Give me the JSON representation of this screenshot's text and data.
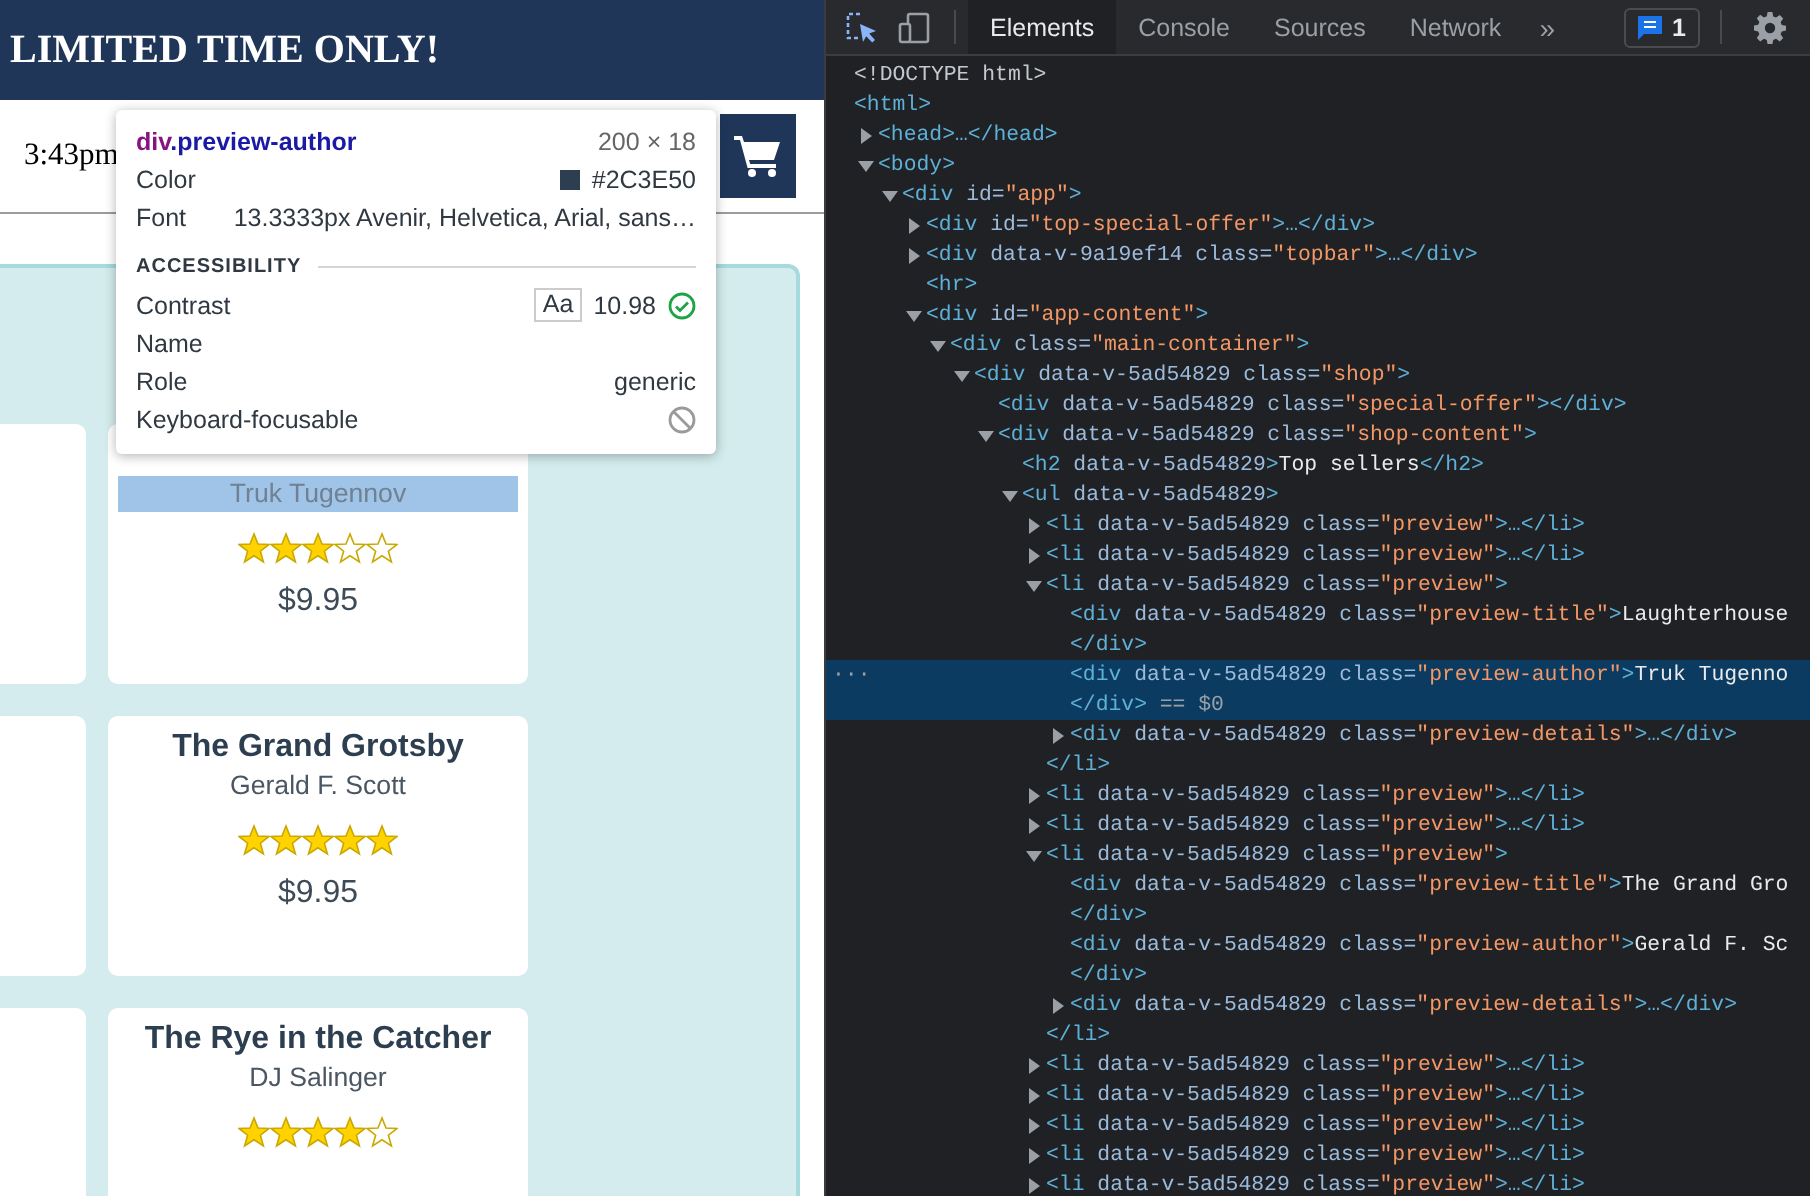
{
  "shop": {
    "banner": "LIMITED TIME ONLY!",
    "time": "3:43pm",
    "books": [
      {
        "author": "Truk Tugennov",
        "stars": 3,
        "price": "$9.95",
        "inspected": true
      },
      {
        "title": "The Grand Grotsby",
        "author": "Gerald F. Scott",
        "stars": 5,
        "price": "$9.95",
        "inspected": false
      },
      {
        "title": "The Rye in the Catcher",
        "author": "DJ Salinger",
        "stars": 4,
        "inspected": false
      }
    ]
  },
  "inspect_tooltip": {
    "tag": "div",
    "selector": ".preview-author",
    "size": "200 × 18",
    "properties": [
      {
        "label": "Color",
        "value": "#2C3E50",
        "color": "#2c3e50"
      },
      {
        "label": "Font",
        "value": "13.3333px Avenir, Helvetica, Arial, sans…"
      }
    ],
    "section": "ACCESSIBILITY",
    "accessibility": [
      {
        "kind": "contrast",
        "label": "Contrast",
        "sample": "Aa",
        "value": "10.98",
        "passes": true
      },
      {
        "kind": "text",
        "label": "Name"
      },
      {
        "kind": "text",
        "label": "Role",
        "value": "generic"
      },
      {
        "kind": "focusable",
        "label": "Keyboard-focusable",
        "focusable": false
      }
    ]
  },
  "devtools": {
    "tabs": [
      {
        "label": "Elements",
        "selected": true
      },
      {
        "label": "Console",
        "selected": false
      },
      {
        "label": "Sources",
        "selected": false
      },
      {
        "label": "Network",
        "selected": false
      }
    ],
    "more": "»",
    "issues_count": "1",
    "row_menu": "···",
    "tree": [
      {
        "line": [
          {
            "kind": "doctype",
            "text": "<!DOCTYPE html>"
          }
        ],
        "selected": false
      },
      {
        "line": [
          {
            "kind": "tag",
            "text": "<html>"
          }
        ],
        "selected": false,
        "children": [
          {
            "line": [
              {
                "kind": "tag",
                "text": "<head>…</head>"
              }
            ],
            "expanded": false,
            "selected": false
          },
          {
            "line": [
              {
                "kind": "tag",
                "text": "<body>"
              }
            ],
            "expanded": true,
            "selected": false,
            "children": [
              {
                "line": [
                  {
                    "kind": "tag",
                    "text": "<div"
                  },
                  {
                    "kind": "attr",
                    "text": " id="
                  },
                  {
                    "kind": "value",
                    "text": "\"app\""
                  },
                  {
                    "kind": "tag",
                    "text": ">"
                  }
                ],
                "expanded": true,
                "selected": false,
                "children": [
                  {
                    "line": [
                      {
                        "kind": "tag",
                        "text": "<div"
                      },
                      {
                        "kind": "attr",
                        "text": " id="
                      },
                      {
                        "kind": "value",
                        "text": "\"top-special-offer\""
                      },
                      {
                        "kind": "tag",
                        "text": ">…</div>"
                      }
                    ],
                    "expanded": false,
                    "selected": false
                  },
                  {
                    "line": [
                      {
                        "kind": "tag",
                        "text": "<div"
                      },
                      {
                        "kind": "attr",
                        "text": " data-v-9a19ef14 class="
                      },
                      {
                        "kind": "value",
                        "text": "\"topbar\""
                      },
                      {
                        "kind": "tag",
                        "text": ">…</div>"
                      }
                    ],
                    "expanded": false,
                    "selected": false
                  },
                  {
                    "line": [
                      {
                        "kind": "tag",
                        "text": "<hr>"
                      }
                    ],
                    "selected": false
                  },
                  {
                    "line": [
                      {
                        "kind": "tag",
                        "text": "<div"
                      },
                      {
                        "kind": "attr",
                        "text": " id="
                      },
                      {
                        "kind": "value",
                        "text": "\"app-content\""
                      },
                      {
                        "kind": "tag",
                        "text": ">"
                      }
                    ],
                    "expanded": true,
                    "selected": false,
                    "children": [
                      {
                        "line": [
                          {
                            "kind": "tag",
                            "text": "<div"
                          },
                          {
                            "kind": "attr",
                            "text": " class="
                          },
                          {
                            "kind": "value",
                            "text": "\"main-container\""
                          },
                          {
                            "kind": "tag",
                            "text": ">"
                          }
                        ],
                        "expanded": true,
                        "selected": false,
                        "children": [
                          {
                            "line": [
                              {
                                "kind": "tag",
                                "text": "<div"
                              },
                              {
                                "kind": "attr",
                                "text": " data-v-5ad54829 class="
                              },
                              {
                                "kind": "value",
                                "text": "\"shop\""
                              },
                              {
                                "kind": "tag",
                                "text": ">"
                              }
                            ],
                            "expanded": true,
                            "selected": false,
                            "children": [
                              {
                                "line": [
                                  {
                                    "kind": "tag",
                                    "text": "<div"
                                  },
                                  {
                                    "kind": "attr",
                                    "text": " data-v-5ad54829 class="
                                  },
                                  {
                                    "kind": "value",
                                    "text": "\"special-offer\""
                                  },
                                  {
                                    "kind": "tag",
                                    "text": "></div>"
                                  }
                                ],
                                "selected": false
                              },
                              {
                                "line": [
                                  {
                                    "kind": "tag",
                                    "text": "<div"
                                  },
                                  {
                                    "kind": "attr",
                                    "text": " data-v-5ad54829 class="
                                  },
                                  {
                                    "kind": "value",
                                    "text": "\"shop-content\""
                                  },
                                  {
                                    "kind": "tag",
                                    "text": ">"
                                  }
                                ],
                                "expanded": true,
                                "selected": false,
                                "children": [
                                  {
                                    "line": [
                                      {
                                        "kind": "tag",
                                        "text": "<h2"
                                      },
                                      {
                                        "kind": "attr",
                                        "text": " data-v-5ad54829"
                                      },
                                      {
                                        "kind": "tag",
                                        "text": ">"
                                      },
                                      {
                                        "kind": "text",
                                        "text": "Top sellers"
                                      },
                                      {
                                        "kind": "tag",
                                        "text": "</h2>"
                                      }
                                    ],
                                    "selected": false
                                  },
                                  {
                                    "line": [
                                      {
                                        "kind": "tag",
                                        "text": "<ul"
                                      },
                                      {
                                        "kind": "attr",
                                        "text": " data-v-5ad54829"
                                      },
                                      {
                                        "kind": "tag",
                                        "text": ">"
                                      }
                                    ],
                                    "expanded": true,
                                    "selected": false,
                                    "children": [
                                      {
                                        "line": [
                                          {
                                            "kind": "tag",
                                            "text": "<li"
                                          },
                                          {
                                            "kind": "attr",
                                            "text": " data-v-5ad54829 class="
                                          },
                                          {
                                            "kind": "value",
                                            "text": "\"preview\""
                                          },
                                          {
                                            "kind": "tag",
                                            "text": ">…</li>"
                                          }
                                        ],
                                        "expanded": false,
                                        "selected": false
                                      },
                                      {
                                        "line": [
                                          {
                                            "kind": "tag",
                                            "text": "<li"
                                          },
                                          {
                                            "kind": "attr",
                                            "text": " data-v-5ad54829 class="
                                          },
                                          {
                                            "kind": "value",
                                            "text": "\"preview\""
                                          },
                                          {
                                            "kind": "tag",
                                            "text": ">…</li>"
                                          }
                                        ],
                                        "expanded": false,
                                        "selected": false
                                      },
                                      {
                                        "line": [
                                          {
                                            "kind": "tag",
                                            "text": "<li"
                                          },
                                          {
                                            "kind": "attr",
                                            "text": " data-v-5ad54829 class="
                                          },
                                          {
                                            "kind": "value",
                                            "text": "\"preview\""
                                          },
                                          {
                                            "kind": "tag",
                                            "text": ">"
                                          }
                                        ],
                                        "expanded": true,
                                        "selected": false,
                                        "end": [
                                          {
                                            "kind": "tag",
                                            "text": "</li>"
                                          }
                                        ],
                                        "children": [
                                          {
                                            "line": [
                                              {
                                                "kind": "tag",
                                                "text": "<div"
                                              },
                                              {
                                                "kind": "attr",
                                                "text": " data-v-5ad54829 class="
                                              },
                                              {
                                                "kind": "value",
                                                "text": "\"preview-title\""
                                              },
                                              {
                                                "kind": "tag",
                                                "text": ">"
                                              },
                                              {
                                                "kind": "text",
                                                "text": "Laughterhouse"
                                              }
                                            ],
                                            "end": [
                                              {
                                                "kind": "tag",
                                                "text": "</div>"
                                              }
                                            ],
                                            "selected": false
                                          },
                                          {
                                            "line": [
                                              {
                                                "kind": "tag",
                                                "text": "<div"
                                              },
                                              {
                                                "kind": "attr",
                                                "text": " data-v-5ad54829 class="
                                              },
                                              {
                                                "kind": "value",
                                                "text": "\"preview-author\""
                                              },
                                              {
                                                "kind": "tag",
                                                "text": ">"
                                              },
                                              {
                                                "kind": "text",
                                                "text": "Truk Tugenno"
                                              }
                                            ],
                                            "end": [
                                              {
                                                "kind": "tag",
                                                "text": "</div>"
                                              },
                                              {
                                                "kind": "meta",
                                                "text": " == $0"
                                              }
                                            ],
                                            "selected": true
                                          },
                                          {
                                            "line": [
                                              {
                                                "kind": "tag",
                                                "text": "<div"
                                              },
                                              {
                                                "kind": "attr",
                                                "text": " data-v-5ad54829 class="
                                              },
                                              {
                                                "kind": "value",
                                                "text": "\"preview-details\""
                                              },
                                              {
                                                "kind": "tag",
                                                "text": ">…</div>"
                                              }
                                            ],
                                            "expanded": false,
                                            "selected": false
                                          }
                                        ]
                                      },
                                      {
                                        "line": [
                                          {
                                            "kind": "tag",
                                            "text": "<li"
                                          },
                                          {
                                            "kind": "attr",
                                            "text": " data-v-5ad54829 class="
                                          },
                                          {
                                            "kind": "value",
                                            "text": "\"preview\""
                                          },
                                          {
                                            "kind": "tag",
                                            "text": ">…</li>"
                                          }
                                        ],
                                        "expanded": false,
                                        "selected": false
                                      },
                                      {
                                        "line": [
                                          {
                                            "kind": "tag",
                                            "text": "<li"
                                          },
                                          {
                                            "kind": "attr",
                                            "text": " data-v-5ad54829 class="
                                          },
                                          {
                                            "kind": "value",
                                            "text": "\"preview\""
                                          },
                                          {
                                            "kind": "tag",
                                            "text": ">…</li>"
                                          }
                                        ],
                                        "expanded": false,
                                        "selected": false
                                      },
                                      {
                                        "line": [
                                          {
                                            "kind": "tag",
                                            "text": "<li"
                                          },
                                          {
                                            "kind": "attr",
                                            "text": " data-v-5ad54829 class="
                                          },
                                          {
                                            "kind": "value",
                                            "text": "\"preview\""
                                          },
                                          {
                                            "kind": "tag",
                                            "text": ">"
                                          }
                                        ],
                                        "expanded": true,
                                        "selected": false,
                                        "end": [
                                          {
                                            "kind": "tag",
                                            "text": "</li>"
                                          }
                                        ],
                                        "children": [
                                          {
                                            "line": [
                                              {
                                                "kind": "tag",
                                                "text": "<div"
                                              },
                                              {
                                                "kind": "attr",
                                                "text": " data-v-5ad54829 class="
                                              },
                                              {
                                                "kind": "value",
                                                "text": "\"preview-title\""
                                              },
                                              {
                                                "kind": "tag",
                                                "text": ">"
                                              },
                                              {
                                                "kind": "text",
                                                "text": "The Grand Gro"
                                              }
                                            ],
                                            "end": [
                                              {
                                                "kind": "tag",
                                                "text": "</div>"
                                              }
                                            ],
                                            "selected": false
                                          },
                                          {
                                            "line": [
                                              {
                                                "kind": "tag",
                                                "text": "<div"
                                              },
                                              {
                                                "kind": "attr",
                                                "text": " data-v-5ad54829 class="
                                              },
                                              {
                                                "kind": "value",
                                                "text": "\"preview-author\""
                                              },
                                              {
                                                "kind": "tag",
                                                "text": ">"
                                              },
                                              {
                                                "kind": "text",
                                                "text": "Gerald F. Sc"
                                              }
                                            ],
                                            "end": [
                                              {
                                                "kind": "tag",
                                                "text": "</div>"
                                              }
                                            ],
                                            "selected": false
                                          },
                                          {
                                            "line": [
                                              {
                                                "kind": "tag",
                                                "text": "<div"
                                              },
                                              {
                                                "kind": "attr",
                                                "text": " data-v-5ad54829 class="
                                              },
                                              {
                                                "kind": "value",
                                                "text": "\"preview-details\""
                                              },
                                              {
                                                "kind": "tag",
                                                "text": ">…</div>"
                                              }
                                            ],
                                            "expanded": false,
                                            "selected": false
                                          }
                                        ]
                                      },
                                      {
                                        "line": [
                                          {
                                            "kind": "tag",
                                            "text": "<li"
                                          },
                                          {
                                            "kind": "attr",
                                            "text": " data-v-5ad54829 class="
                                          },
                                          {
                                            "kind": "value",
                                            "text": "\"preview\""
                                          },
                                          {
                                            "kind": "tag",
                                            "text": ">…</li>"
                                          }
                                        ],
                                        "expanded": false,
                                        "selected": false
                                      },
                                      {
                                        "line": [
                                          {
                                            "kind": "tag",
                                            "text": "<li"
                                          },
                                          {
                                            "kind": "attr",
                                            "text": " data-v-5ad54829 class="
                                          },
                                          {
                                            "kind": "value",
                                            "text": "\"preview\""
                                          },
                                          {
                                            "kind": "tag",
                                            "text": ">…</li>"
                                          }
                                        ],
                                        "expanded": false,
                                        "selected": false
                                      },
                                      {
                                        "line": [
                                          {
                                            "kind": "tag",
                                            "text": "<li"
                                          },
                                          {
                                            "kind": "attr",
                                            "text": " data-v-5ad54829 class="
                                          },
                                          {
                                            "kind": "value",
                                            "text": "\"preview\""
                                          },
                                          {
                                            "kind": "tag",
                                            "text": ">…</li>"
                                          }
                                        ],
                                        "expanded": false,
                                        "selected": false
                                      },
                                      {
                                        "line": [
                                          {
                                            "kind": "tag",
                                            "text": "<li"
                                          },
                                          {
                                            "kind": "attr",
                                            "text": " data-v-5ad54829 class="
                                          },
                                          {
                                            "kind": "value",
                                            "text": "\"preview\""
                                          },
                                          {
                                            "kind": "tag",
                                            "text": ">…</li>"
                                          }
                                        ],
                                        "expanded": false,
                                        "selected": false
                                      },
                                      {
                                        "line": [
                                          {
                                            "kind": "tag",
                                            "text": "<li"
                                          },
                                          {
                                            "kind": "attr",
                                            "text": " data-v-5ad54829 class="
                                          },
                                          {
                                            "kind": "value",
                                            "text": "\"preview\""
                                          },
                                          {
                                            "kind": "tag",
                                            "text": ">…</li>"
                                          }
                                        ],
                                        "expanded": false,
                                        "selected": false
                                      }
                                    ]
                                  }
                                ]
                              }
                            ]
                          }
                        ]
                      }
                    ]
                  }
                ]
              }
            ]
          }
        ]
      }
    ]
  }
}
